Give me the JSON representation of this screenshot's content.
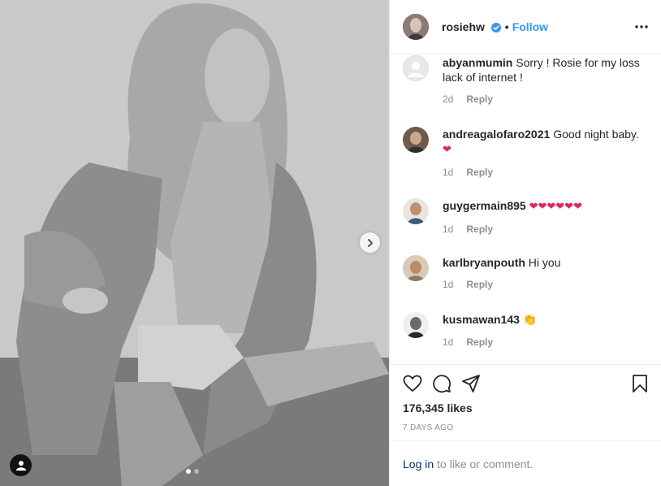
{
  "post": {
    "username": "rosiehw",
    "bullet": "•",
    "follow_label": "Follow",
    "likes": "176,345 likes",
    "time_ago": "7 DAYS AGO",
    "carousel": {
      "slides": 2,
      "active_index": 0
    }
  },
  "comments": [
    {
      "user": "abyanmumin",
      "text": "Sorry ! Rosie for my loss lack of internet !",
      "emoji": "",
      "age": "2d",
      "reply": "Reply",
      "avatar_color": "#d6d6d6"
    },
    {
      "user": "andreagalofaro2021",
      "text": "Good night baby.",
      "emoji": "❤",
      "age": "1d",
      "reply": "Reply",
      "avatar_color": "#6f5a4c"
    },
    {
      "user": "guygermain895",
      "text": "",
      "emoji": "❤❤❤❤❤❤",
      "age": "1d",
      "reply": "Reply",
      "avatar_color": "#b58f6b"
    },
    {
      "user": "karlbryanpouth",
      "text": "Hi you",
      "emoji": "",
      "age": "1d",
      "reply": "Reply",
      "avatar_color": "#c6a68a"
    },
    {
      "user": "kusmawan143",
      "text": "",
      "emoji": "👏",
      "age": "1d",
      "reply": "Reply",
      "avatar_color": "#3b3b3b"
    }
  ],
  "login": {
    "link": "Log in",
    "rest": " to like or comment."
  },
  "icons": [
    "user-tag-icon",
    "chevron-right-icon",
    "verified-badge-icon",
    "more-options-icon",
    "heart-icon",
    "comment-icon",
    "share-icon",
    "bookmark-icon"
  ],
  "colors": {
    "accent": "#3897f0",
    "heart": "#e0245e",
    "muted": "#8e8e8e",
    "link": "#003569"
  }
}
